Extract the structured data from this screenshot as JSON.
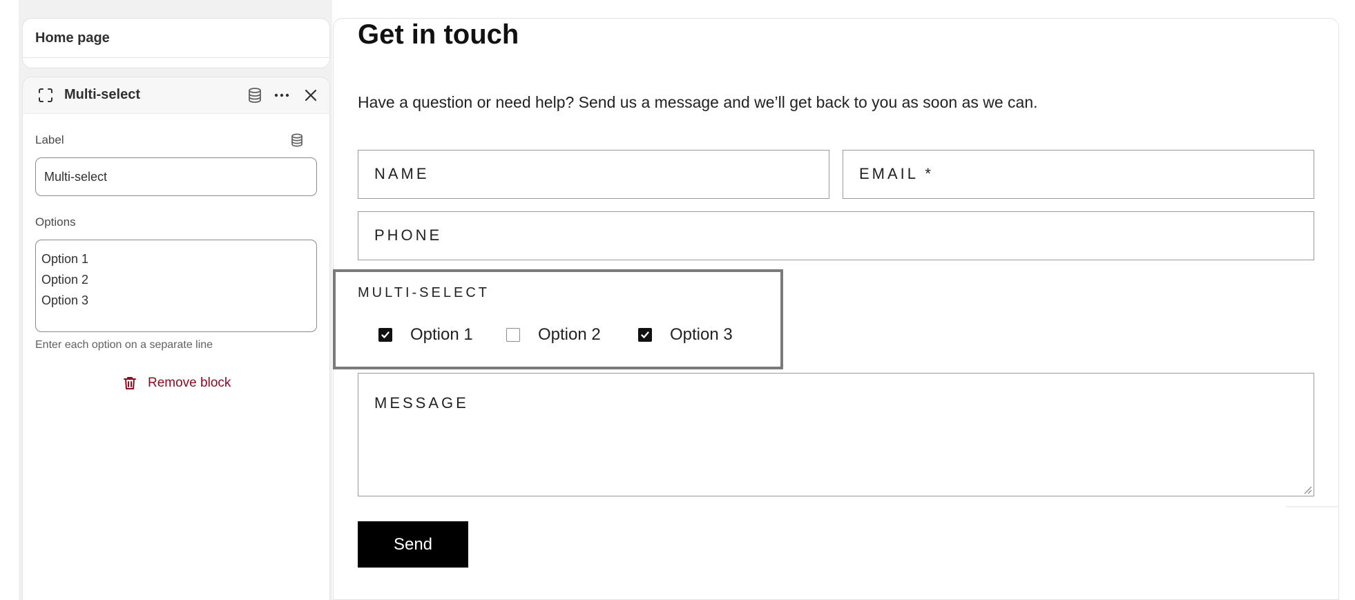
{
  "sidebar": {
    "page_card": {
      "title": "Home page"
    },
    "block_panel": {
      "title": "Multi-select",
      "block_icon": "block-frame-icon",
      "actions": {
        "connect_icon": "database-icon",
        "more_icon": "more-horizontal-icon",
        "close_icon": "close-icon"
      },
      "label_field": {
        "label": "Label",
        "value": "Multi-select",
        "connect_icon": "database-icon"
      },
      "options_field": {
        "label": "Options",
        "lines": [
          "Option 1",
          "Option 2",
          "Option 3"
        ],
        "help": "Enter each option on a separate line"
      },
      "remove": {
        "label": "Remove block",
        "icon": "trash-icon",
        "color": "#8e0b21"
      }
    }
  },
  "preview": {
    "title": "Get in touch",
    "subtitle": "Have a question or need help? Send us a message and we’ll get back to you as soon as we can.",
    "fields": {
      "name": "NAME",
      "email": "EMAIL *",
      "phone": "PHONE",
      "message": "MESSAGE"
    },
    "multi_select": {
      "label": "MULTI-SELECT",
      "options": [
        {
          "label": "Option 1",
          "checked": true
        },
        {
          "label": "Option 2",
          "checked": false
        },
        {
          "label": "Option 3",
          "checked": true
        }
      ]
    },
    "send_label": "Send",
    "colors": {
      "button_bg": "#000000",
      "button_text": "#ffffff",
      "selection_outline": "#7a7a7a"
    }
  }
}
